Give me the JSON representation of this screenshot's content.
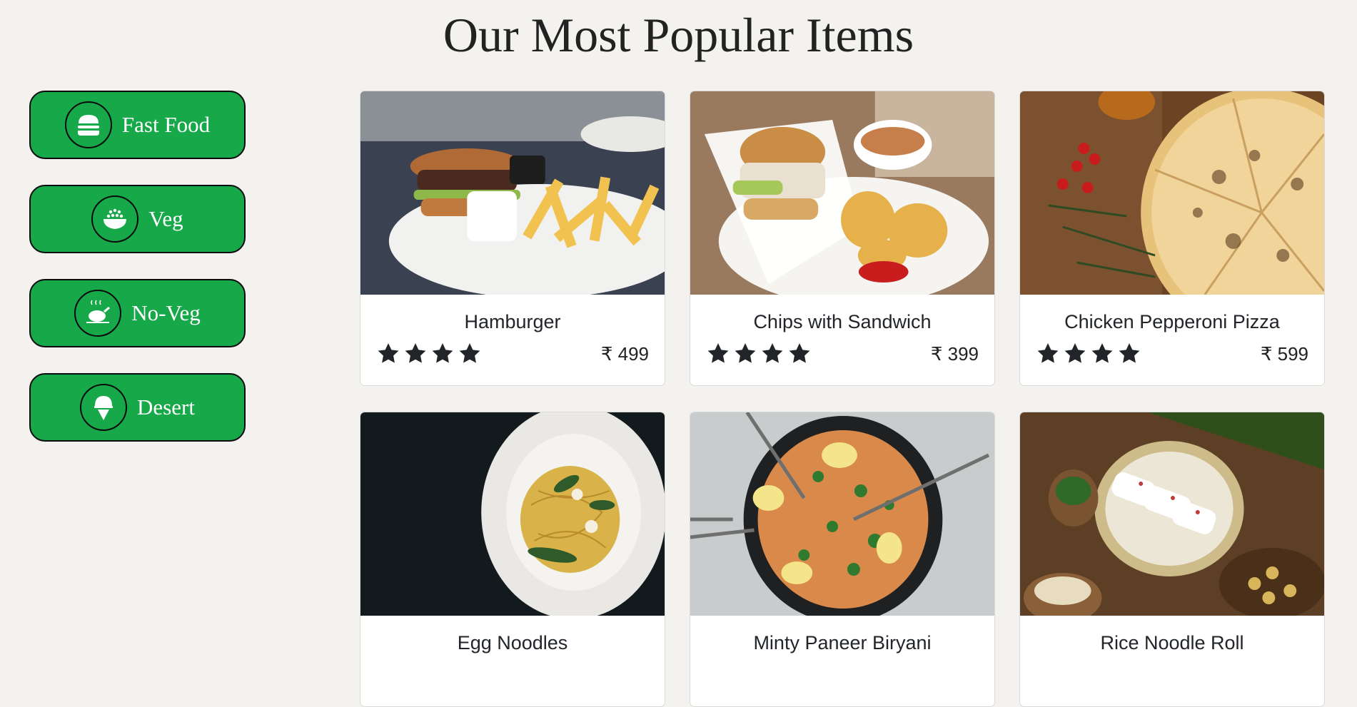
{
  "page": {
    "title": "Our Most Popular Items"
  },
  "categories": [
    {
      "label": "Fast Food",
      "icon": "burger-icon"
    },
    {
      "label": "Veg",
      "icon": "veg-bowl-icon"
    },
    {
      "label": "No-Veg",
      "icon": "roast-chicken-icon"
    },
    {
      "label": "Desert",
      "icon": "ice-cream-icon"
    }
  ],
  "items": [
    {
      "name": "Hamburger",
      "rating": 4,
      "price": "₹ 499",
      "image": "burger-fries-photo"
    },
    {
      "name": "Chips with Sandwich",
      "rating": 4,
      "price": "₹ 399",
      "image": "sandwich-waffle-fries-photo"
    },
    {
      "name": "Chicken Pepperoni Pizza",
      "rating": 4,
      "price": "₹ 599",
      "image": "pizza-photo"
    },
    {
      "name": "Egg Noodles",
      "image": "noodles-plate-photo"
    },
    {
      "name": "Minty Paneer Biryani",
      "image": "biryani-pan-photo"
    },
    {
      "name": "Rice Noodle Roll",
      "image": "rice-noodle-roll-photo"
    }
  ],
  "colors": {
    "accent": "#17a84a",
    "background": "#f3f2ef",
    "star": "#212529"
  }
}
